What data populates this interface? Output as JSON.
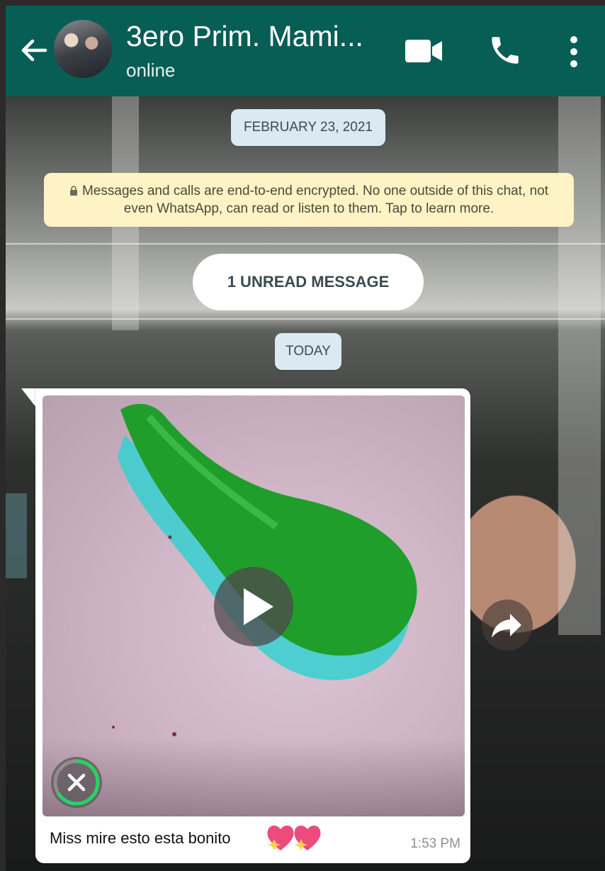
{
  "header": {
    "title": "3ero Prim. Mami...",
    "status": "online",
    "icons": [
      "back-arrow-icon",
      "group-avatar",
      "video-call-icon",
      "voice-call-icon",
      "more-options-icon"
    ]
  },
  "chat": {
    "date_label_1": "FEBRUARY 23, 2021",
    "encryption_notice": "Messages and calls are end-to-end encrypted. No one outside of this chat, not even WhatsApp, can read or listen to them. Tap to learn more.",
    "unread_label": "1 UNREAD MESSAGE",
    "date_label_2": "TODAY"
  },
  "message": {
    "caption": "Miss mire esto esta bonito",
    "time": "1:53 PM",
    "media_type": "video",
    "icons": [
      "play-icon",
      "cancel-download-icon",
      "forward-icon",
      "hearts-emoji"
    ]
  },
  "colors": {
    "header": "#075e54",
    "date_pill": "#dbe9f1",
    "encryption_bg": "#fdf3c5",
    "download_ring": "#25d366"
  }
}
